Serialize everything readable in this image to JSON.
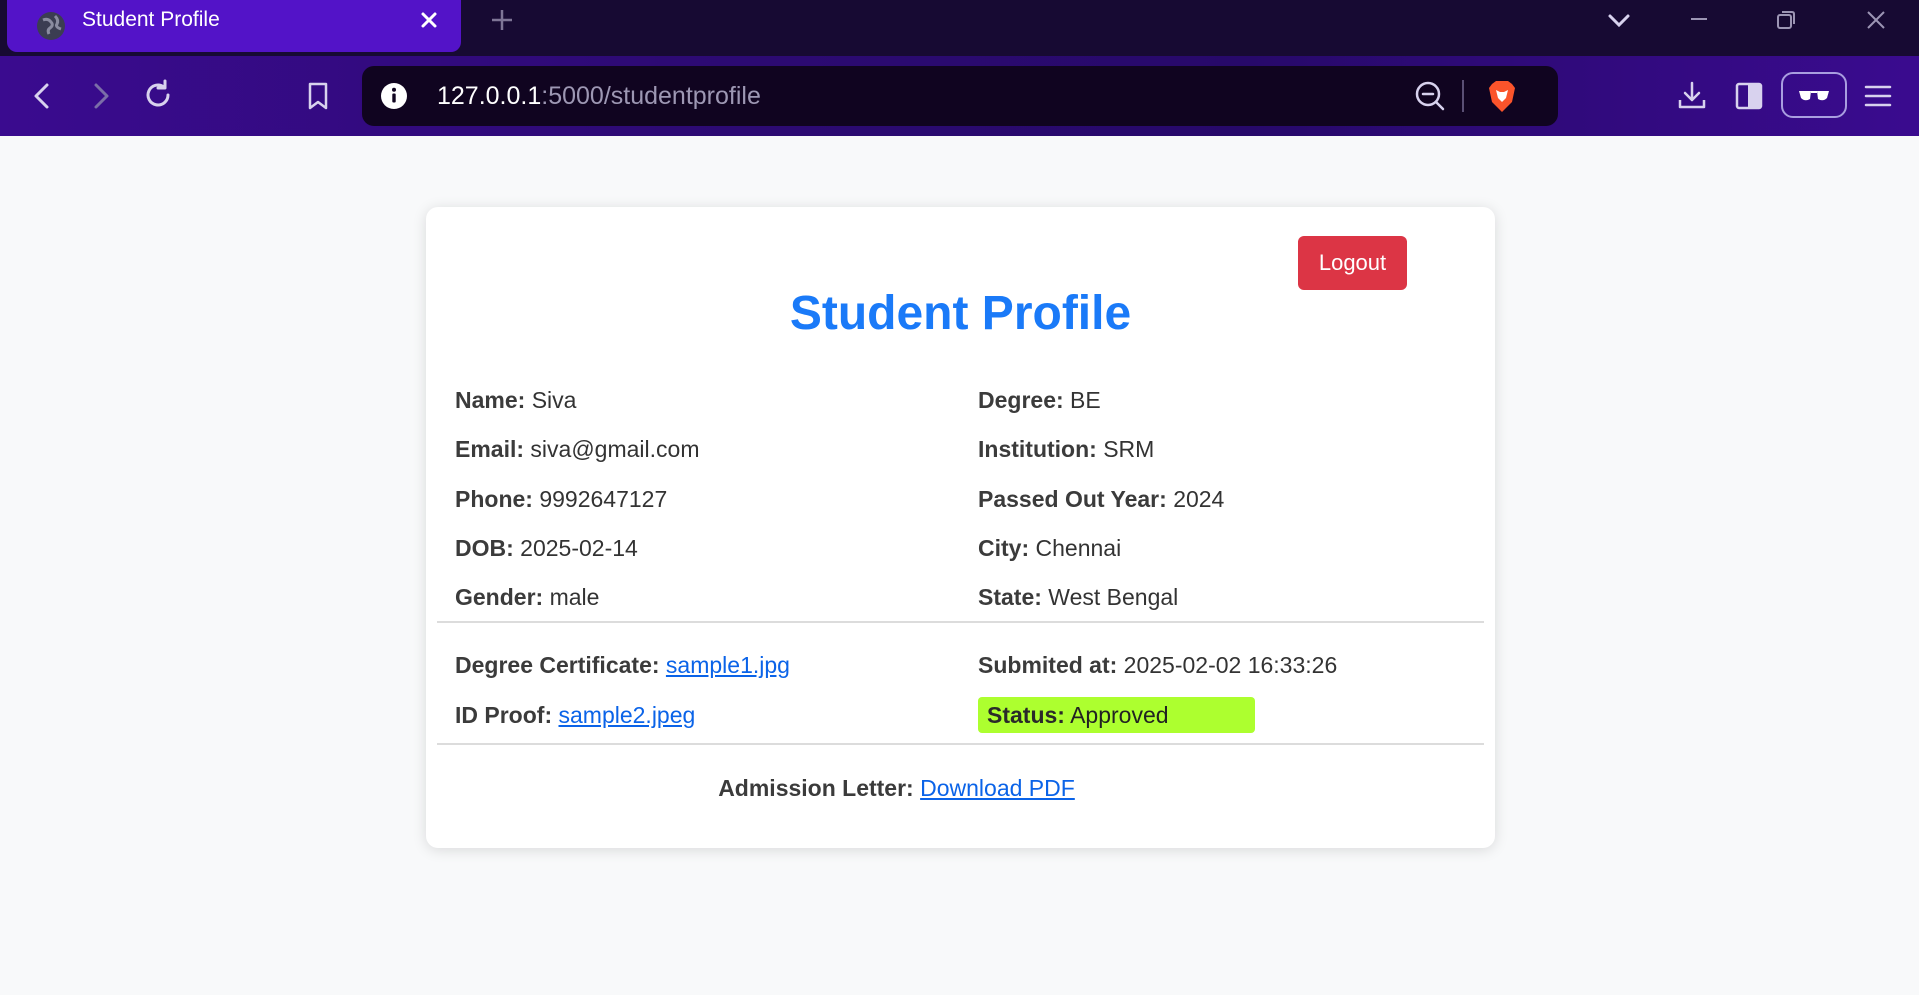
{
  "browser": {
    "tab_title": "Student Profile",
    "url_host": "127.0.0.1",
    "url_path": ":5000/studentprofile",
    "icons": [
      "globe-icon",
      "close-icon",
      "plus-icon",
      "chevron-down-icon",
      "minimize-icon",
      "restore-icon",
      "window-close-icon",
      "back-icon",
      "forward-icon",
      "reload-icon",
      "bookmark-icon",
      "info-icon",
      "zoom-out-icon",
      "brave-shields-icon",
      "download-icon",
      "sidebar-icon",
      "reader-glasses-icon",
      "menu-icon"
    ],
    "colors": {
      "tab": "#5313c8",
      "tabbar": "#170a33",
      "toolbar": "#2d0a74",
      "omnibox": "#100420"
    }
  },
  "profile": {
    "heading": "Student Profile",
    "logout_label": "Logout",
    "left": [
      {
        "label": "Name:",
        "value": "Siva"
      },
      {
        "label": "Email:",
        "value": "siva@gmail.com"
      },
      {
        "label": "Phone:",
        "value": "9992647127"
      },
      {
        "label": "DOB:",
        "value": "2025-02-14"
      },
      {
        "label": "Gender:",
        "value": "male"
      }
    ],
    "right": [
      {
        "label": "Degree:",
        "value": "BE"
      },
      {
        "label": "Institution:",
        "value": "SRM"
      },
      {
        "label": "Passed Out Year:",
        "value": "2024"
      },
      {
        "label": "City:",
        "value": "Chennai"
      },
      {
        "label": "State:",
        "value": "West Bengal"
      }
    ],
    "documents": {
      "degree_certificate_label": "Degree Certificate:",
      "degree_certificate_link": "sample1.jpg",
      "id_proof_label": "ID Proof:",
      "id_proof_link": "sample2.jpeg",
      "submitted_label": "Submited at:",
      "submitted_value": "2025-02-02 16:33:26",
      "status_label": "Status:",
      "status_value": "Approved"
    },
    "admission": {
      "label": "Admission Letter:",
      "link": "Download PDF"
    },
    "colors": {
      "heading": "#1a7af8",
      "logout": "#dc3545",
      "status_bg": "#adff2f",
      "link": "#0a63e8"
    }
  }
}
